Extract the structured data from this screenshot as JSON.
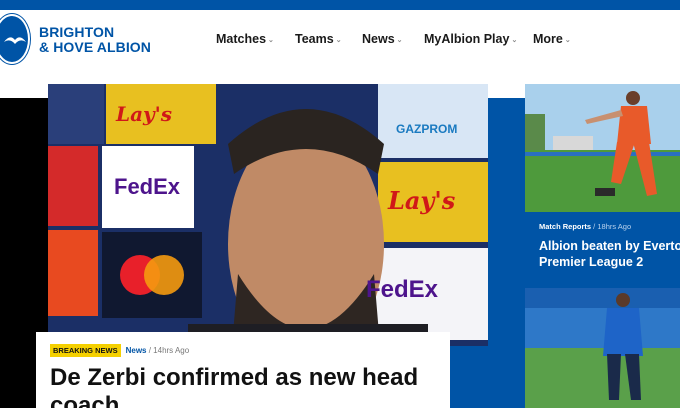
{
  "header": {
    "club_name_line1": "BRIGHTON",
    "club_name_line2": "& HOVE ALBION",
    "brand_color": "#0054a6",
    "logo_icon": "seagull-crest-icon"
  },
  "nav": {
    "items": [
      {
        "label": "Matches",
        "chevron": "chevron-down-icon"
      },
      {
        "label": "Teams",
        "chevron": "chevron-down-icon"
      },
      {
        "label": "News",
        "chevron": "chevron-down-icon"
      },
      {
        "label": "MyAlbion Play",
        "chevron": "chevron-down-icon"
      },
      {
        "label": "More",
        "chevron": "chevron-down-icon"
      }
    ]
  },
  "hero": {
    "sponsor_boards": [
      "Lay's",
      "FedEx",
      "GAZPROM",
      "Lay's",
      "FedEx"
    ],
    "badge": "BREAKING NEWS",
    "category": "News",
    "separator": " / ",
    "time": "14hrs Ago",
    "headline": "De Zerbi confirmed as new head coach"
  },
  "side_articles": [
    {
      "category": "Match Reports",
      "separator": " / ",
      "time": "18hrs Ago",
      "title_line1": "Albion beaten by Everto",
      "title_line2": "Premier League 2"
    },
    {
      "category": "",
      "time": "",
      "title_line1": "",
      "title_line2": ""
    }
  ],
  "colors": {
    "accent_blue": "#0054a6",
    "badge_yellow": "#f5d000"
  }
}
